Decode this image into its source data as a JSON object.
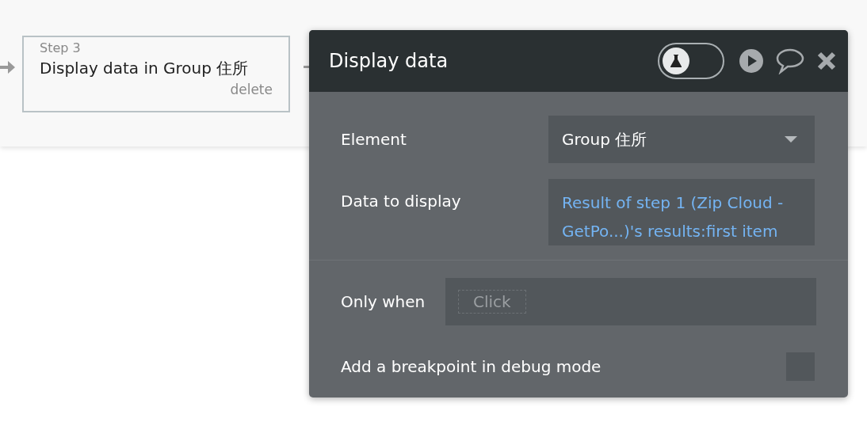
{
  "step_card": {
    "step": "Step 3",
    "title": "Display data in Group 住所",
    "delete": "delete"
  },
  "panel": {
    "title": "Display data",
    "test_toggle": {
      "on": false
    },
    "fields": [
      {
        "kind": "dropdown",
        "label": "Element",
        "value": "Group 住所"
      },
      {
        "kind": "expression",
        "label": "Data to display",
        "value": "Result of step 1 (Zip Cloud - GetPo...)'s results:first item"
      }
    ],
    "only_when": {
      "label": "Only when",
      "placeholder": "Click"
    },
    "breakpoint": {
      "label": "Add a breakpoint in debug mode",
      "checked": false
    }
  }
}
